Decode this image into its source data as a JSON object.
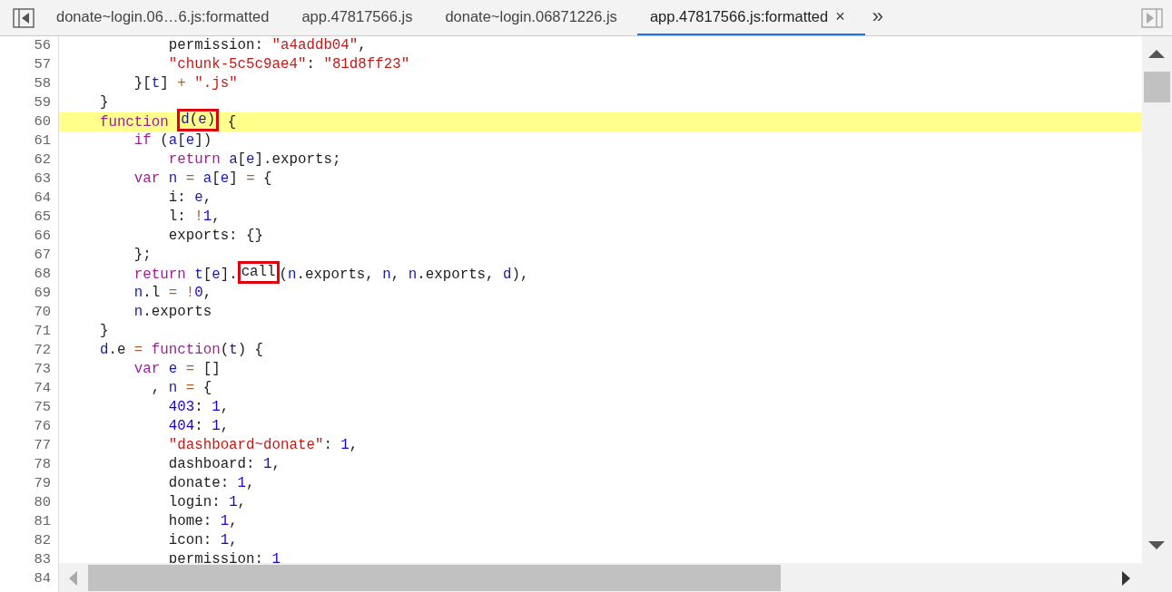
{
  "tabs": [
    {
      "label": "donate~login.06…6.js:formatted",
      "selected": false
    },
    {
      "label": "app.47817566.js",
      "selected": false
    },
    {
      "label": "donate~login.06871226.js",
      "selected": false
    },
    {
      "label": "app.47817566.js:formatted",
      "selected": true,
      "close": "×"
    }
  ],
  "more_tabs": "»",
  "editor": {
    "lines": [
      {
        "number": "56",
        "highlighted": false,
        "parts": [
          {
            "kind": "plain",
            "text": "            permission: "
          },
          {
            "kind": "str",
            "text": "\"a4addb04\""
          },
          {
            "kind": "plain",
            "text": ","
          }
        ]
      },
      {
        "number": "57",
        "highlighted": false,
        "parts": [
          {
            "kind": "str",
            "text": "            \"chunk-5c5c9ae4\""
          },
          {
            "kind": "plain",
            "text": ": "
          },
          {
            "kind": "str",
            "text": "\"81d8ff23\""
          }
        ]
      },
      {
        "number": "58",
        "highlighted": false,
        "parts": [
          {
            "kind": "plain",
            "text": "        }["
          },
          {
            "kind": "var",
            "text": "t"
          },
          {
            "kind": "plain",
            "text": "] "
          },
          {
            "kind": "op",
            "text": "+ "
          },
          {
            "kind": "str",
            "text": "\".js\""
          }
        ]
      },
      {
        "number": "59",
        "highlighted": false,
        "parts": [
          {
            "kind": "plain",
            "text": "    }"
          }
        ]
      },
      {
        "number": "60",
        "highlighted": true,
        "parts": [
          {
            "kind": "kw",
            "text": "    function "
          },
          {
            "kind": "box",
            "parts": [
              {
                "kind": "var",
                "text": "d"
              },
              {
                "kind": "plain",
                "text": "("
              },
              {
                "kind": "var",
                "text": "e"
              },
              {
                "kind": "plain",
                "text": ")"
              }
            ]
          },
          {
            "kind": "plain",
            "text": " {"
          }
        ]
      },
      {
        "number": "61",
        "highlighted": false,
        "parts": [
          {
            "kind": "kw",
            "text": "        if"
          },
          {
            "kind": "plain",
            "text": " ("
          },
          {
            "kind": "var",
            "text": "a"
          },
          {
            "kind": "plain",
            "text": "["
          },
          {
            "kind": "var",
            "text": "e"
          },
          {
            "kind": "plain",
            "text": "])"
          }
        ]
      },
      {
        "number": "62",
        "highlighted": false,
        "parts": [
          {
            "kind": "kw",
            "text": "            return "
          },
          {
            "kind": "var",
            "text": "a"
          },
          {
            "kind": "plain",
            "text": "["
          },
          {
            "kind": "var",
            "text": "e"
          },
          {
            "kind": "plain",
            "text": "].exports;"
          }
        ]
      },
      {
        "number": "63",
        "highlighted": false,
        "parts": [
          {
            "kind": "kw",
            "text": "        var "
          },
          {
            "kind": "var",
            "text": "n "
          },
          {
            "kind": "op",
            "text": "= "
          },
          {
            "kind": "var",
            "text": "a"
          },
          {
            "kind": "plain",
            "text": "["
          },
          {
            "kind": "var",
            "text": "e"
          },
          {
            "kind": "plain",
            "text": "] "
          },
          {
            "kind": "op",
            "text": "="
          },
          {
            "kind": "plain",
            "text": " {"
          }
        ]
      },
      {
        "number": "64",
        "highlighted": false,
        "parts": [
          {
            "kind": "plain",
            "text": "            i: "
          },
          {
            "kind": "var",
            "text": "e"
          },
          {
            "kind": "plain",
            "text": ","
          }
        ]
      },
      {
        "number": "65",
        "highlighted": false,
        "parts": [
          {
            "kind": "plain",
            "text": "            l: "
          },
          {
            "kind": "op",
            "text": "!"
          },
          {
            "kind": "num",
            "text": "1"
          },
          {
            "kind": "plain",
            "text": ","
          }
        ]
      },
      {
        "number": "66",
        "highlighted": false,
        "parts": [
          {
            "kind": "plain",
            "text": "            exports: {}"
          }
        ]
      },
      {
        "number": "67",
        "highlighted": false,
        "parts": [
          {
            "kind": "plain",
            "text": "        };"
          }
        ]
      },
      {
        "number": "68",
        "highlighted": false,
        "parts": [
          {
            "kind": "kw",
            "text": "        return "
          },
          {
            "kind": "var",
            "text": "t"
          },
          {
            "kind": "plain",
            "text": "["
          },
          {
            "kind": "var",
            "text": "e"
          },
          {
            "kind": "plain",
            "text": "]."
          },
          {
            "kind": "box",
            "parts": [
              {
                "kind": "plain",
                "text": "call"
              }
            ]
          },
          {
            "kind": "plain",
            "text": "("
          },
          {
            "kind": "var",
            "text": "n"
          },
          {
            "kind": "plain",
            "text": ".exports, "
          },
          {
            "kind": "var",
            "text": "n"
          },
          {
            "kind": "plain",
            "text": ", "
          },
          {
            "kind": "var",
            "text": "n"
          },
          {
            "kind": "plain",
            "text": ".exports, "
          },
          {
            "kind": "var",
            "text": "d"
          },
          {
            "kind": "plain",
            "text": "),"
          }
        ]
      },
      {
        "number": "69",
        "highlighted": false,
        "parts": [
          {
            "kind": "var",
            "text": "        n"
          },
          {
            "kind": "plain",
            "text": ".l "
          },
          {
            "kind": "op",
            "text": "= !"
          },
          {
            "kind": "num",
            "text": "0"
          },
          {
            "kind": "plain",
            "text": ","
          }
        ]
      },
      {
        "number": "70",
        "highlighted": false,
        "parts": [
          {
            "kind": "var",
            "text": "        n"
          },
          {
            "kind": "plain",
            "text": ".exports"
          }
        ]
      },
      {
        "number": "71",
        "highlighted": false,
        "parts": [
          {
            "kind": "plain",
            "text": "    }"
          }
        ]
      },
      {
        "number": "72",
        "highlighted": false,
        "parts": [
          {
            "kind": "var",
            "text": "    d"
          },
          {
            "kind": "plain",
            "text": ".e "
          },
          {
            "kind": "op",
            "text": "= "
          },
          {
            "kind": "kw",
            "text": "function"
          },
          {
            "kind": "plain",
            "text": "("
          },
          {
            "kind": "var",
            "text": "t"
          },
          {
            "kind": "plain",
            "text": ") {"
          }
        ]
      },
      {
        "number": "73",
        "highlighted": false,
        "parts": [
          {
            "kind": "kw",
            "text": "        var "
          },
          {
            "kind": "var",
            "text": "e "
          },
          {
            "kind": "op",
            "text": "="
          },
          {
            "kind": "plain",
            "text": " []"
          }
        ]
      },
      {
        "number": "74",
        "highlighted": false,
        "parts": [
          {
            "kind": "plain",
            "text": "          , "
          },
          {
            "kind": "var",
            "text": "n "
          },
          {
            "kind": "op",
            "text": "="
          },
          {
            "kind": "plain",
            "text": " {"
          }
        ]
      },
      {
        "number": "75",
        "highlighted": false,
        "parts": [
          {
            "kind": "num",
            "text": "            403"
          },
          {
            "kind": "plain",
            "text": ": "
          },
          {
            "kind": "num",
            "text": "1"
          },
          {
            "kind": "plain",
            "text": ","
          }
        ]
      },
      {
        "number": "76",
        "highlighted": false,
        "parts": [
          {
            "kind": "num",
            "text": "            404"
          },
          {
            "kind": "plain",
            "text": ": "
          },
          {
            "kind": "num",
            "text": "1"
          },
          {
            "kind": "plain",
            "text": ","
          }
        ]
      },
      {
        "number": "77",
        "highlighted": false,
        "parts": [
          {
            "kind": "str",
            "text": "            \"dashboard~donate\""
          },
          {
            "kind": "plain",
            "text": ": "
          },
          {
            "kind": "num",
            "text": "1"
          },
          {
            "kind": "plain",
            "text": ","
          }
        ]
      },
      {
        "number": "78",
        "highlighted": false,
        "parts": [
          {
            "kind": "plain",
            "text": "            dashboard: "
          },
          {
            "kind": "num",
            "text": "1"
          },
          {
            "kind": "plain",
            "text": ","
          }
        ]
      },
      {
        "number": "79",
        "highlighted": false,
        "parts": [
          {
            "kind": "plain",
            "text": "            donate: "
          },
          {
            "kind": "num",
            "text": "1"
          },
          {
            "kind": "plain",
            "text": ","
          }
        ]
      },
      {
        "number": "80",
        "highlighted": false,
        "parts": [
          {
            "kind": "plain",
            "text": "            login: "
          },
          {
            "kind": "num",
            "text": "1"
          },
          {
            "kind": "plain",
            "text": ","
          }
        ]
      },
      {
        "number": "81",
        "highlighted": false,
        "parts": [
          {
            "kind": "plain",
            "text": "            home: "
          },
          {
            "kind": "num",
            "text": "1"
          },
          {
            "kind": "plain",
            "text": ","
          }
        ]
      },
      {
        "number": "82",
        "highlighted": false,
        "parts": [
          {
            "kind": "plain",
            "text": "            icon: "
          },
          {
            "kind": "num",
            "text": "1"
          },
          {
            "kind": "plain",
            "text": ","
          }
        ]
      },
      {
        "number": "83",
        "highlighted": false,
        "parts": [
          {
            "kind": "plain",
            "text": "            permission: "
          },
          {
            "kind": "num",
            "text": "1"
          }
        ]
      },
      {
        "number": "84"
      }
    ]
  }
}
